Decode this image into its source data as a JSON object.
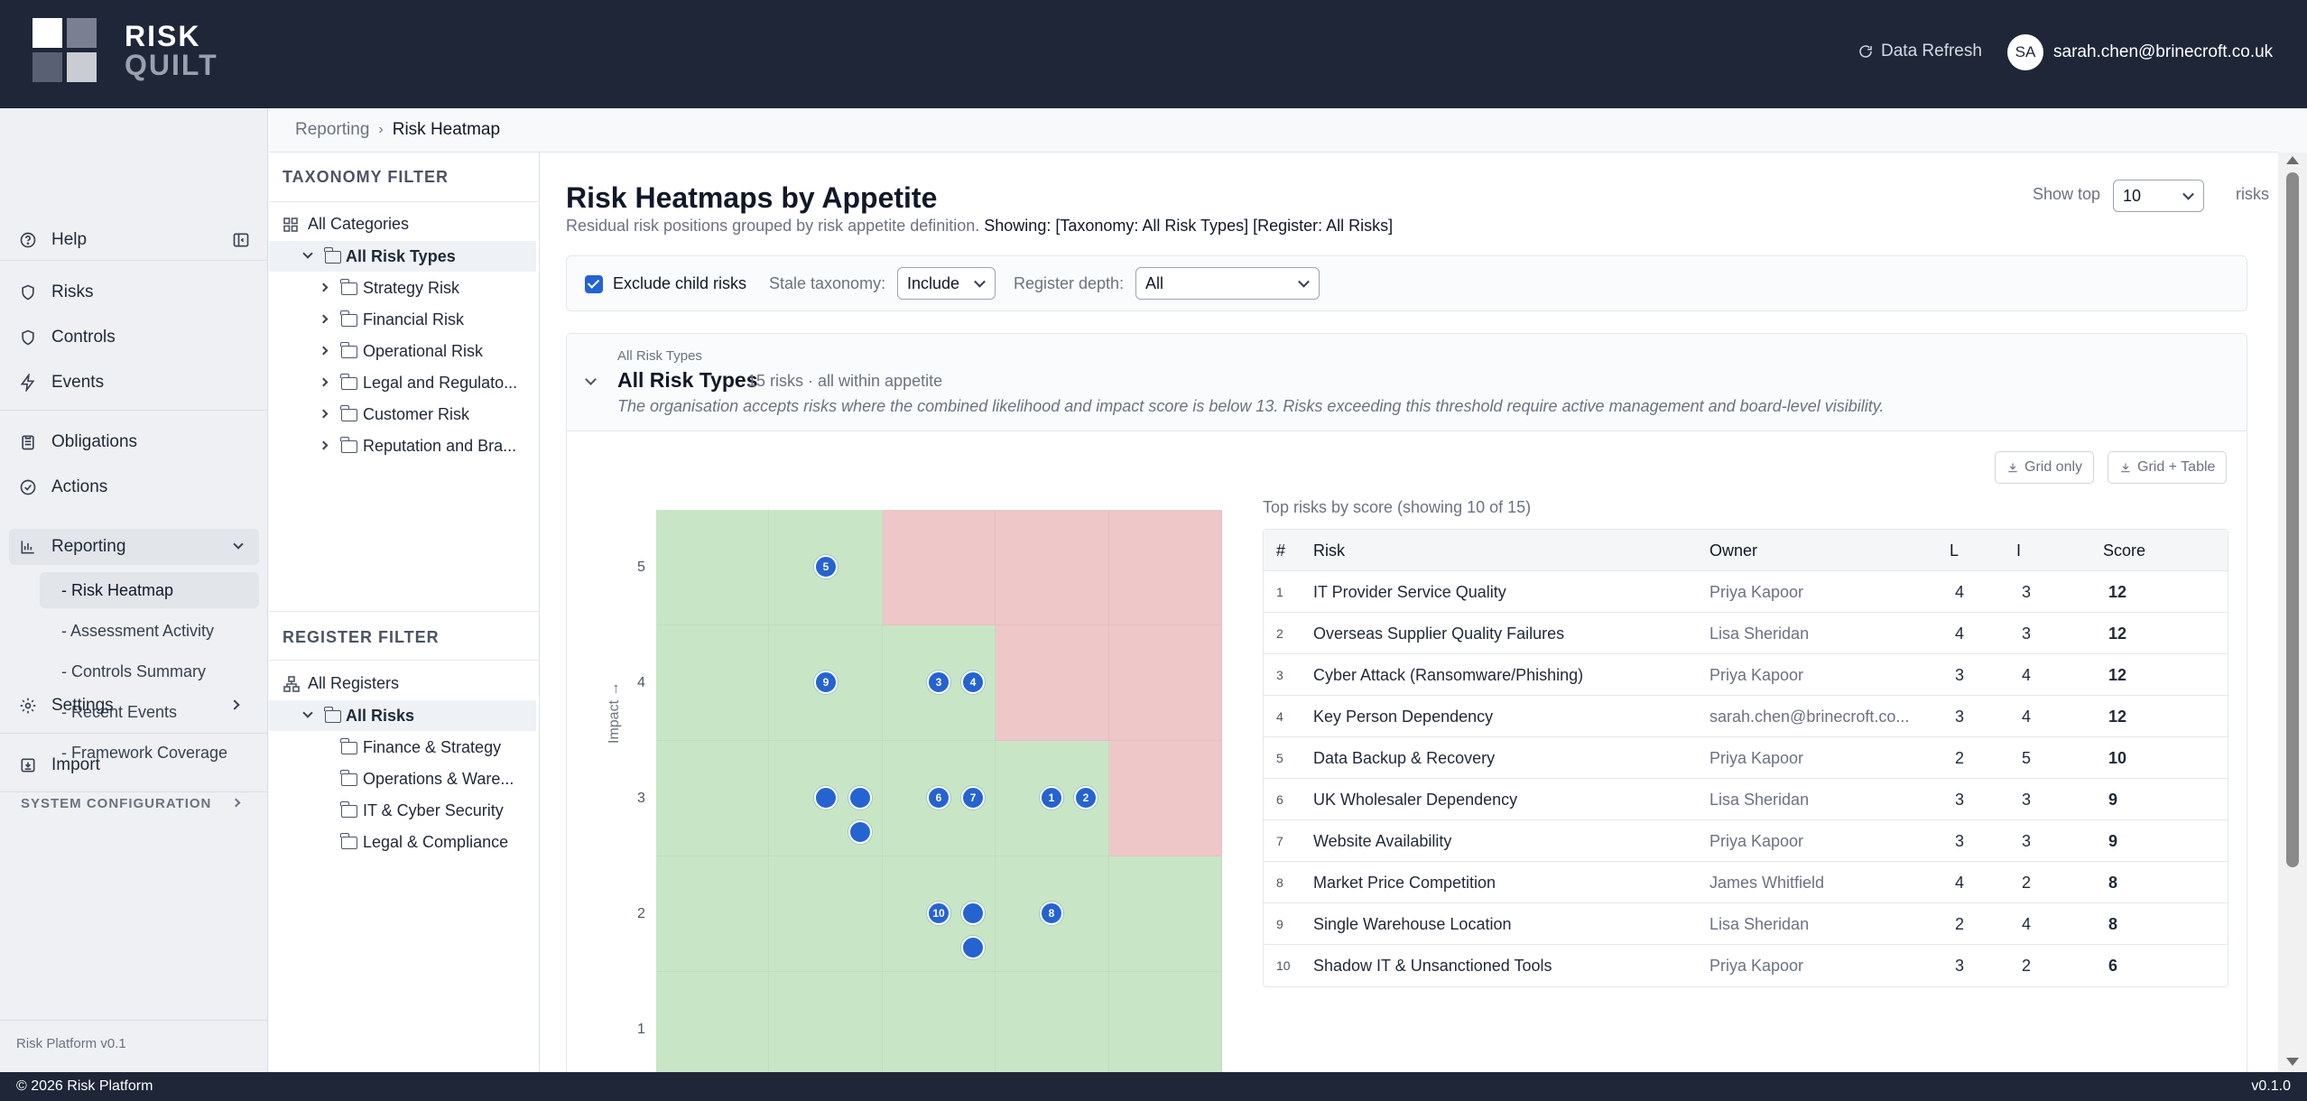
{
  "brand": {
    "line1": "RISK",
    "line2": "QUILT"
  },
  "topbar": {
    "refresh_label": "Data Refresh",
    "avatar_initials": "SA",
    "user_email": "sarah.chen@brinecroft.co.uk"
  },
  "sidebar": {
    "help": "Help",
    "risks": "Risks",
    "controls": "Controls",
    "events": "Events",
    "obligations": "Obligations",
    "actions": "Actions",
    "reporting": "Reporting",
    "reporting_items": [
      "- Risk Heatmap",
      "- Assessment Activity",
      "- Controls Summary",
      "- Recent Events",
      "- Framework Coverage"
    ],
    "settings": "Settings",
    "import": "Import",
    "system_config": "SYSTEM CONFIGURATION",
    "version": "Risk Platform v0.1"
  },
  "breadcrumb": {
    "parent": "Reporting",
    "current": "Risk Heatmap"
  },
  "taxonomy_filter": {
    "title": "TAXONOMY FILTER",
    "all": "All Categories",
    "root": "All Risk Types",
    "children": [
      "Strategy Risk",
      "Financial Risk",
      "Operational Risk",
      "Legal and Regulato...",
      "Customer Risk",
      "Reputation and Bra..."
    ]
  },
  "register_filter": {
    "title": "REGISTER FILTER",
    "all": "All Registers",
    "root": "All Risks",
    "children": [
      "Finance & Strategy",
      "Operations & Ware...",
      "IT & Cyber Security",
      "Legal & Compliance"
    ]
  },
  "page": {
    "title": "Risk Heatmaps by Appetite",
    "subtitle": "Residual risk positions grouped by risk appetite definition.",
    "showing": "Showing: [Taxonomy: All Risk Types] [Register: All Risks]",
    "show_top_label": "Show top",
    "show_top_value": "10",
    "risks_label": "risks"
  },
  "filters": {
    "exclude_child": "Exclude child risks",
    "stale_label": "Stale taxonomy:",
    "stale_value": "Include",
    "depth_label": "Register depth:",
    "depth_value": "All"
  },
  "section": {
    "kicker": "All Risk Types",
    "title": "All Risk Types",
    "meta": "15 risks · all within appetite",
    "description": "The organisation accepts risks where the combined likelihood and impact score is below 13. Risks exceeding this threshold require active management and board-level visibility.",
    "btn_grid_only": "Grid only",
    "btn_grid_table": "Grid + Table"
  },
  "heatmap": {
    "y_label": "Impact →",
    "y_ticks": [
      "5",
      "4",
      "3",
      "2",
      "1"
    ],
    "colors": {
      "green": "#c8e6c6",
      "red": "#eec7c8",
      "dot": "#2563d1"
    }
  },
  "table": {
    "caption": "Top risks by score (showing 10 of 15)",
    "headers": [
      "#",
      "Risk",
      "Owner",
      "L",
      "I",
      "Score"
    ],
    "rows": [
      [
        "1",
        "IT Provider Service Quality",
        "Priya Kapoor",
        "4",
        "3",
        "12"
      ],
      [
        "2",
        "Overseas Supplier Quality Failures",
        "Lisa Sheridan",
        "4",
        "3",
        "12"
      ],
      [
        "3",
        "Cyber Attack (Ransomware/Phishing)",
        "Priya Kapoor",
        "3",
        "4",
        "12"
      ],
      [
        "4",
        "Key Person Dependency",
        "sarah.chen@brinecroft.co...",
        "3",
        "4",
        "12"
      ],
      [
        "5",
        "Data Backup & Recovery",
        "Priya Kapoor",
        "2",
        "5",
        "10"
      ],
      [
        "6",
        "UK Wholesaler Dependency",
        "Lisa Sheridan",
        "3",
        "3",
        "9"
      ],
      [
        "7",
        "Website Availability",
        "Priya Kapoor",
        "3",
        "3",
        "9"
      ],
      [
        "8",
        "Market Price Competition",
        "James Whitfield",
        "4",
        "2",
        "8"
      ],
      [
        "9",
        "Single Warehouse Location",
        "Lisa Sheridan",
        "2",
        "4",
        "8"
      ],
      [
        "10",
        "Shadow IT & Unsanctioned Tools",
        "Priya Kapoor",
        "3",
        "2",
        "6"
      ]
    ]
  },
  "footer": {
    "left": "© 2026 Risk Platform",
    "right": "v0.1.0"
  }
}
